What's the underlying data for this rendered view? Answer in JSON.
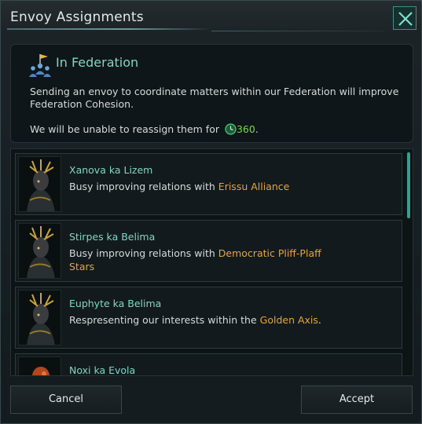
{
  "window": {
    "title": "Envoy Assignments"
  },
  "info": {
    "heading": "In Federation",
    "description": "Sending an envoy to coordinate matters within our Federation will improve Federation Cohesion.",
    "cooldown_prefix": "We will be unable to reassign them for ",
    "cooldown_value": "360",
    "cooldown_suffix": "."
  },
  "envoys": [
    {
      "name": "Xanova ka Lizem",
      "status_prefix": "Busy improving relations with ",
      "target": "Erissu Alliance",
      "status_suffix": ""
    },
    {
      "name": "Stirpes ka Belima",
      "status_prefix": "Busy improving relations with ",
      "target": "Democratic Pliff-Plaff Stars",
      "status_suffix": ""
    },
    {
      "name": "Euphyte ka Belima",
      "status_prefix": "Respresenting our interests within the ",
      "target": "Golden Axis",
      "status_suffix": "."
    },
    {
      "name": "Noxi ka Evola",
      "status_prefix": "",
      "target": "",
      "status_suffix": ""
    }
  ],
  "buttons": {
    "cancel": "Cancel",
    "accept": "Accept"
  },
  "colors": {
    "accent_teal": "#7fd6c2",
    "highlight_orange": "#e5a53a",
    "cooldown_green": "#7fd64a"
  }
}
